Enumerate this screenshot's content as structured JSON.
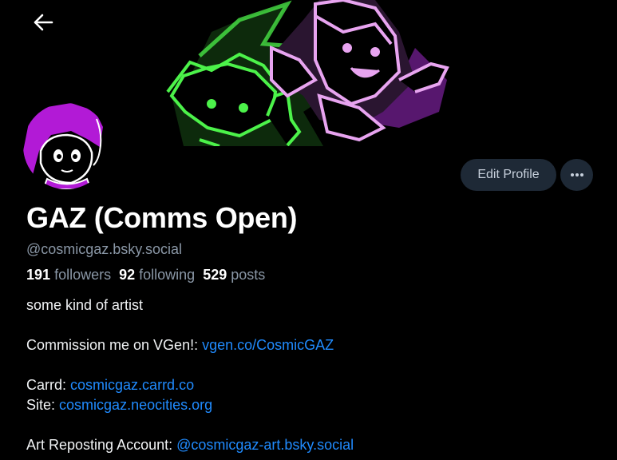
{
  "profile": {
    "display_name": "GAZ (Comms Open)",
    "handle": "@cosmicgaz.bsky.social",
    "stats": {
      "followers_count": "191",
      "followers_label": "followers",
      "following_count": "92",
      "following_label": "following",
      "posts_count": "529",
      "posts_label": "posts"
    },
    "actions": {
      "edit_label": "Edit Profile",
      "more_icon": "ellipsis-icon"
    },
    "bio": {
      "line1": "some kind of artist",
      "commission_prefix": "Commission me on VGen!:",
      "commission_link": "vgen.co/CosmicGAZ",
      "carrd_prefix": "Carrd:",
      "carrd_link": "cosmicgaz.carrd.co",
      "site_prefix": "Site:",
      "site_link": "cosmicgaz.neocities.org",
      "repost_prefix": "Art Reposting Account:",
      "repost_link": "@cosmicgaz-art.bsky.social"
    }
  },
  "colors": {
    "background": "#000000",
    "link": "#208bfe",
    "muted": "#8a97a6",
    "button_bg": "#1e2936",
    "banner_green": "#4cf24a",
    "banner_pink": "#e8a4f0",
    "avatar_purple": "#b21ad6"
  },
  "icons": {
    "back": "arrow-left-icon"
  }
}
